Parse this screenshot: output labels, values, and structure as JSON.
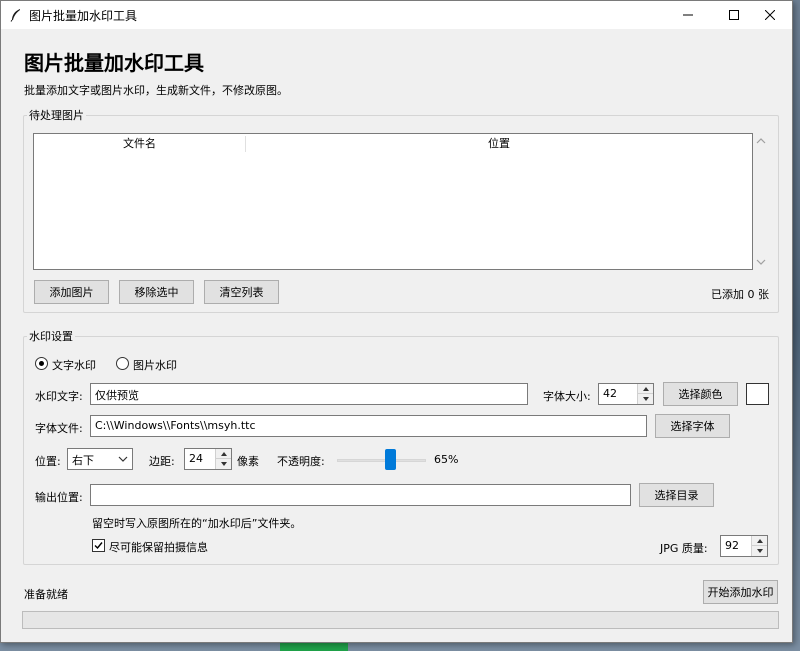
{
  "window": {
    "title": "图片批量加水印工具",
    "icon": "feather-icon"
  },
  "header": {
    "title": "图片批量加水印工具",
    "subtitle": "批量添加文字或图片水印，生成新文件，不修改原图。"
  },
  "images_group": {
    "label": "待处理图片",
    "columns": [
      "文件名",
      "位置"
    ],
    "rows": [],
    "buttons": {
      "add": "添加图片",
      "remove": "移除选中",
      "clear": "清空列表"
    },
    "count_text": "已添加 0 张"
  },
  "settings_group": {
    "label": "水印设置",
    "mode_text": "文字水印",
    "mode_image": "图片水印",
    "mode_selected": "text",
    "text_label": "水印文字:",
    "text_value": "仅供预览",
    "font_size_label": "字体大小:",
    "font_size_value": "42",
    "choose_color": "选择颜色",
    "color_value": "#ffffff",
    "font_file_label": "字体文件:",
    "font_file_value": "C:\\\\Windows\\\\Fonts\\\\msyh.ttc",
    "choose_font": "选择字体",
    "position_label": "位置:",
    "position_value": "右下",
    "margin_label": "边距:",
    "margin_value": "24",
    "margin_unit": "像素",
    "opacity_label": "不透明度:",
    "opacity_value": 65,
    "opacity_text": "65%",
    "output_label": "输出位置:",
    "output_value": "",
    "choose_dir": "选择目录",
    "output_hint": "留空时写入原图所在的“加水印后”文件夹。",
    "keep_exif_label": "尽可能保留拍摄信息",
    "keep_exif_checked": true,
    "jpg_quality_label": "JPG 质量:",
    "jpg_quality_value": "92"
  },
  "footer": {
    "status": "准备就绪",
    "start_button": "开始添加水印",
    "progress": 0
  }
}
